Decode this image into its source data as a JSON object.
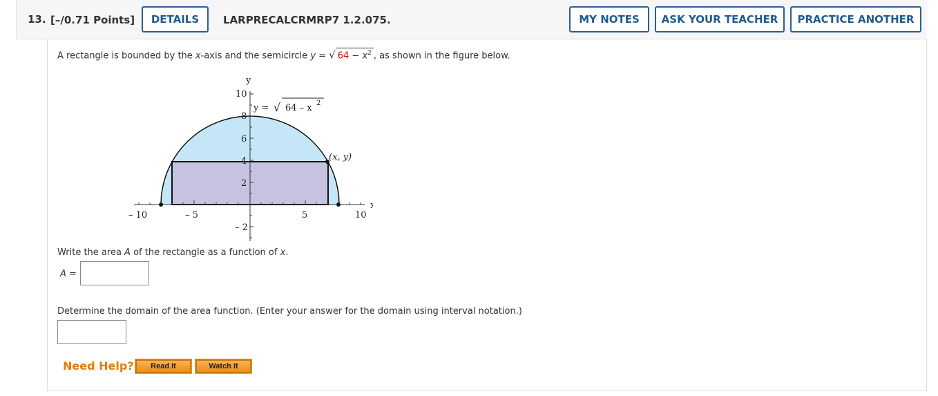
{
  "header": {
    "question_number": "13.",
    "points": "[–/0.71 Points]",
    "details_label": "DETAILS",
    "question_code": "LARPRECALCRMRP7 1.2.075.",
    "my_notes_label": "MY NOTES",
    "ask_teacher_label": "ASK YOUR TEACHER",
    "practice_label": "PRACTICE ANOTHER"
  },
  "problem": {
    "intro_prefix": "A rectangle is bounded by the ",
    "intro_var": "x",
    "intro_mid": "-axis and the semicircle ",
    "eq_lhs": "y = ",
    "eq_radicand_num": "64",
    "eq_radicand_rest": " − x",
    "eq_exp": "2",
    "intro_suffix": ",  as shown in the figure below.",
    "q1_prefix": "Write the area ",
    "q1_var_a": "A",
    "q1_mid": " of the rectangle as a function of ",
    "q1_var_x": "x",
    "q1_suffix": ".",
    "answer_a_label": "A =",
    "answer_a_value": "",
    "q2_text": "Determine the domain of the area function. (Enter your answer for the domain using interval notation.)",
    "answer_domain_value": ""
  },
  "figure": {
    "y_axis_label": "y",
    "x_axis_label": "x",
    "x_ticks": [
      "– 10",
      "– 5",
      "5",
      "10"
    ],
    "y_ticks": [
      "10",
      "8",
      "6",
      "4",
      "2",
      "– 2"
    ],
    "curve_label_lhs": "y = ",
    "curve_label_rad": "64 – x",
    "curve_label_exp": "2",
    "point_label": "(x, y)",
    "semicircle_fill": "#c5e6f6",
    "rect_fill": "#c6c3e1"
  },
  "help": {
    "label": "Need Help?",
    "read_it": "Read It",
    "watch_it": "Watch It"
  }
}
